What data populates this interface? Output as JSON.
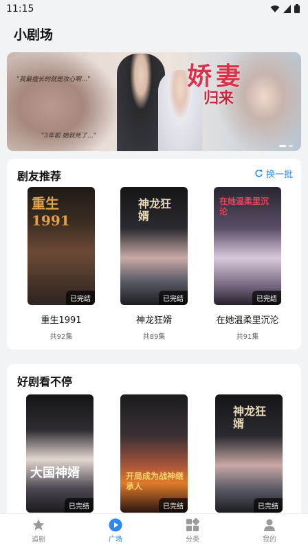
{
  "status_bar": {
    "time": "11:15"
  },
  "page_title": "小剧场",
  "banner": {
    "quote1": "\"我最擅长的就是攻心啊…\"",
    "quote2": "\"3年前 她就死了…\"",
    "title_line1": "娇妻",
    "title_line2": "归来"
  },
  "recommend": {
    "title": "剧友推荐",
    "refresh_label": "换一批",
    "items": [
      {
        "name": "重生1991",
        "episodes": "共92集",
        "badge": "已完结",
        "poster_text": "重生 1991"
      },
      {
        "name": "神龙狂婿",
        "episodes": "共89集",
        "badge": "已完结",
        "poster_text": "神龙狂婿"
      },
      {
        "name": "在她温柔里沉沦",
        "episodes": "共91集",
        "badge": "已完结",
        "poster_text": "在她温柔里沉沦"
      }
    ]
  },
  "nonstop": {
    "title": "好剧看不停",
    "items": [
      {
        "badge": "已完结",
        "poster_text": "大国神婿"
      },
      {
        "badge": "已完结",
        "poster_text": "开局成为战神继承人"
      },
      {
        "badge": "已完结",
        "poster_text": "神龙狂婿"
      }
    ]
  },
  "tabs": [
    {
      "label": "追剧",
      "icon": "star-icon",
      "active": false
    },
    {
      "label": "广场",
      "icon": "play-icon",
      "active": true
    },
    {
      "label": "分类",
      "icon": "grid-icon",
      "active": false
    },
    {
      "label": "我的",
      "icon": "user-icon",
      "active": false
    }
  ],
  "colors": {
    "accent": "#2b88f5",
    "banner_title": "#d8324b"
  }
}
